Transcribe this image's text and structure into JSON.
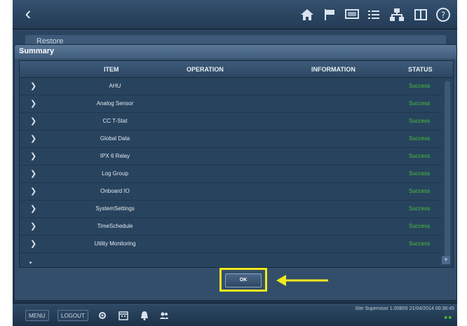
{
  "toolbar": {
    "back_icon": "chevron-left",
    "icons": [
      "home-icon",
      "flag-icon",
      "monitor-icon",
      "list-icon",
      "network-icon",
      "book-icon",
      "help-icon"
    ]
  },
  "background_panel": {
    "title": "Restore"
  },
  "dialog": {
    "title": "Summary",
    "columns": [
      "ITEM",
      "OPERATION",
      "INFORMATION",
      "STATUS"
    ],
    "rows": [
      {
        "item": "AHU",
        "status": "Success"
      },
      {
        "item": "Analog Sensor",
        "status": "Success"
      },
      {
        "item": "CC T-Stat",
        "status": "Success"
      },
      {
        "item": "Global Data",
        "status": "Success"
      },
      {
        "item": "IPX 6 Relay",
        "status": "Success"
      },
      {
        "item": "Log Group",
        "status": "Success"
      },
      {
        "item": "Onboard IO",
        "status": "Success"
      },
      {
        "item": "SystemSettings",
        "status": "Success"
      },
      {
        "item": "TimeSchedule",
        "status": "Success"
      },
      {
        "item": "Utility Monitoring",
        "status": "Success"
      }
    ],
    "ok_label": "OK"
  },
  "annotation": {
    "highlight_color": "#f1e81e"
  },
  "status_colors": {
    "success": "#46c23a"
  },
  "bottombar": {
    "menu_label": "MENU",
    "logout_label": "LOGOUT",
    "icons": [
      "settings-icon",
      "calendar-icon",
      "alarm-bell-icon",
      "users-icon"
    ],
    "site_info": "Site Supervisor 1.00B55 21/04/2014 00:36:45"
  }
}
